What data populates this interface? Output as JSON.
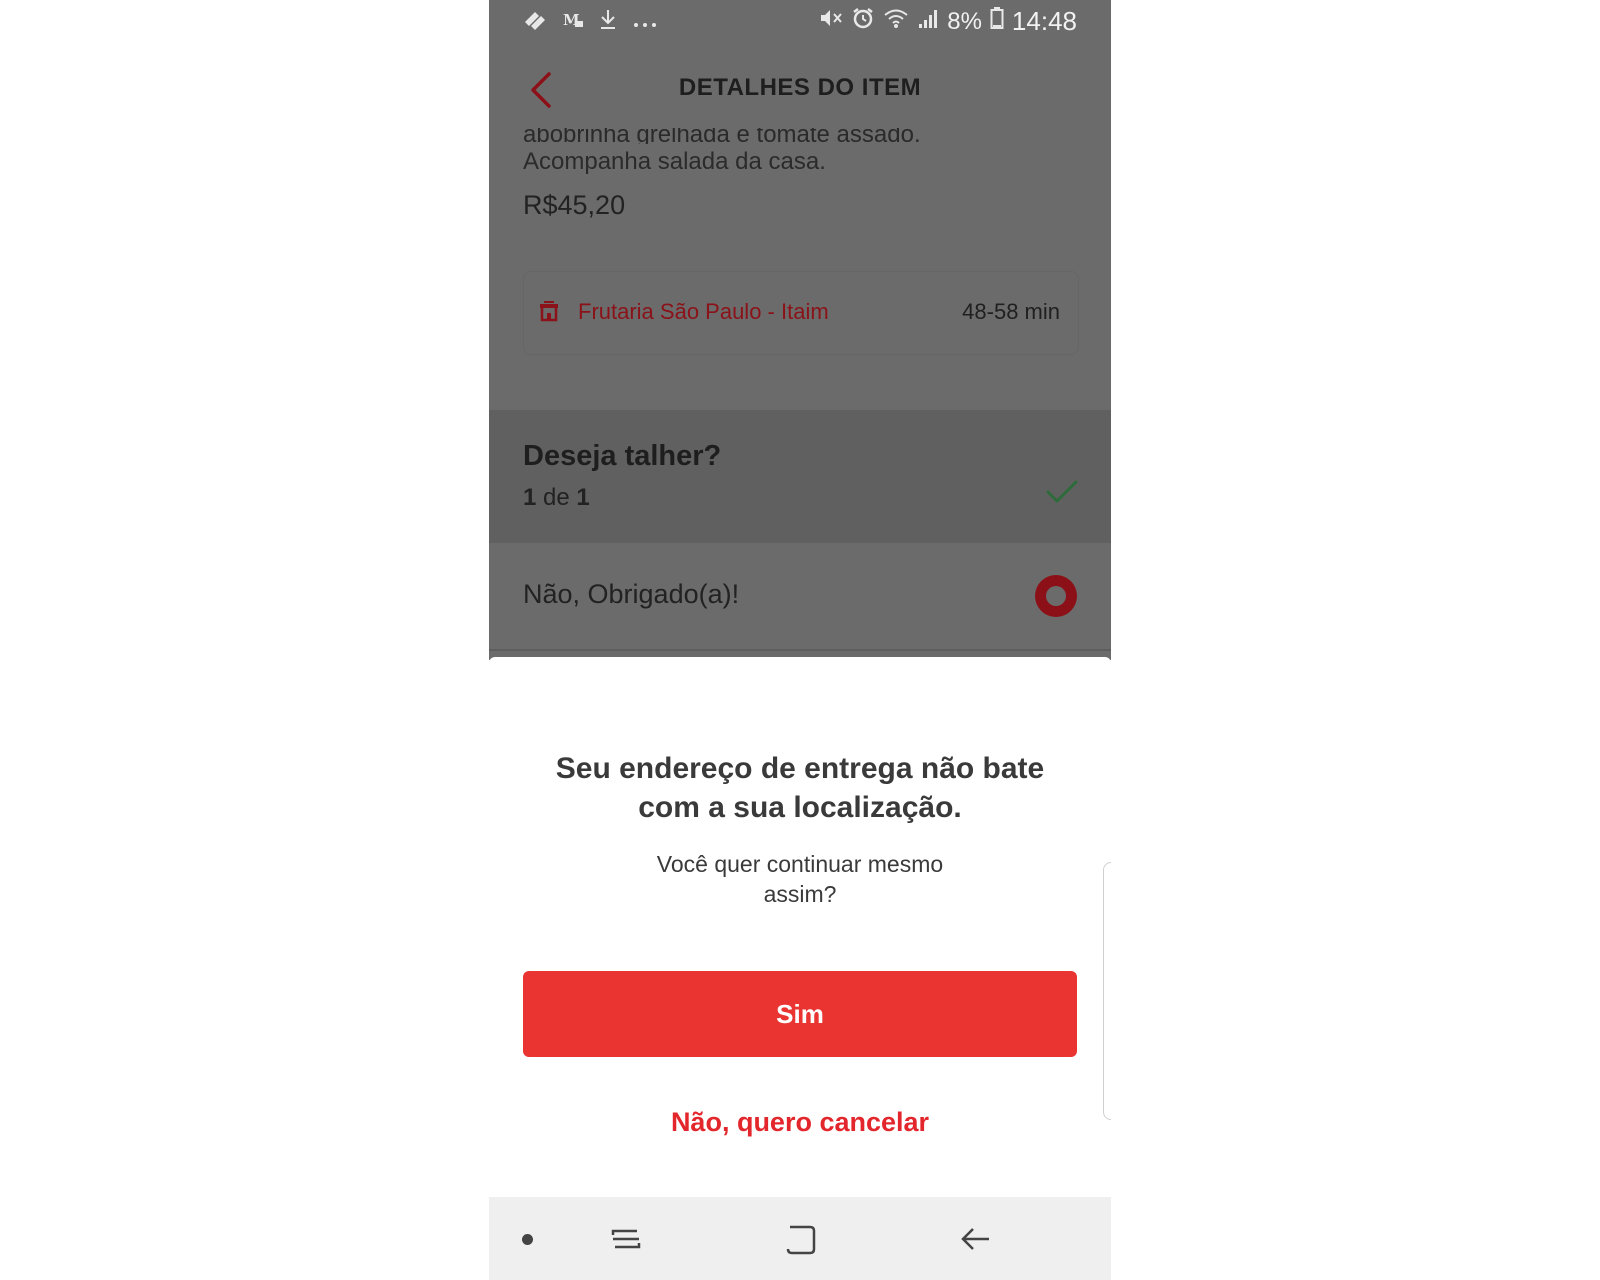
{
  "status_bar": {
    "battery": "8%",
    "time": "14:48"
  },
  "header": {
    "title": "DETALHES DO ITEM"
  },
  "item": {
    "description_cut": "abobrinha grelhada e tomate assado.",
    "description": "Acompanha salada da casa.",
    "price": "R$45,20"
  },
  "store": {
    "name": "Frutaria São Paulo - Itaim",
    "delivery_time": "48-58 min"
  },
  "section": {
    "title": "Deseja talher?",
    "count_current": "1",
    "count_of": "de",
    "count_total": "1"
  },
  "option": {
    "label": "Não, Obrigado(a)!"
  },
  "dialog": {
    "title": "Seu endereço de entrega não bate com a sua localização.",
    "subtitle": "Você quer continuar mesmo assim?",
    "confirm_label": "Sim",
    "cancel_label": "Não, quero cancelar"
  },
  "colors": {
    "accent": "#ea3432",
    "link": "#e3262c",
    "overlay": "#6b6b6b",
    "check": "#2e6b3a"
  }
}
